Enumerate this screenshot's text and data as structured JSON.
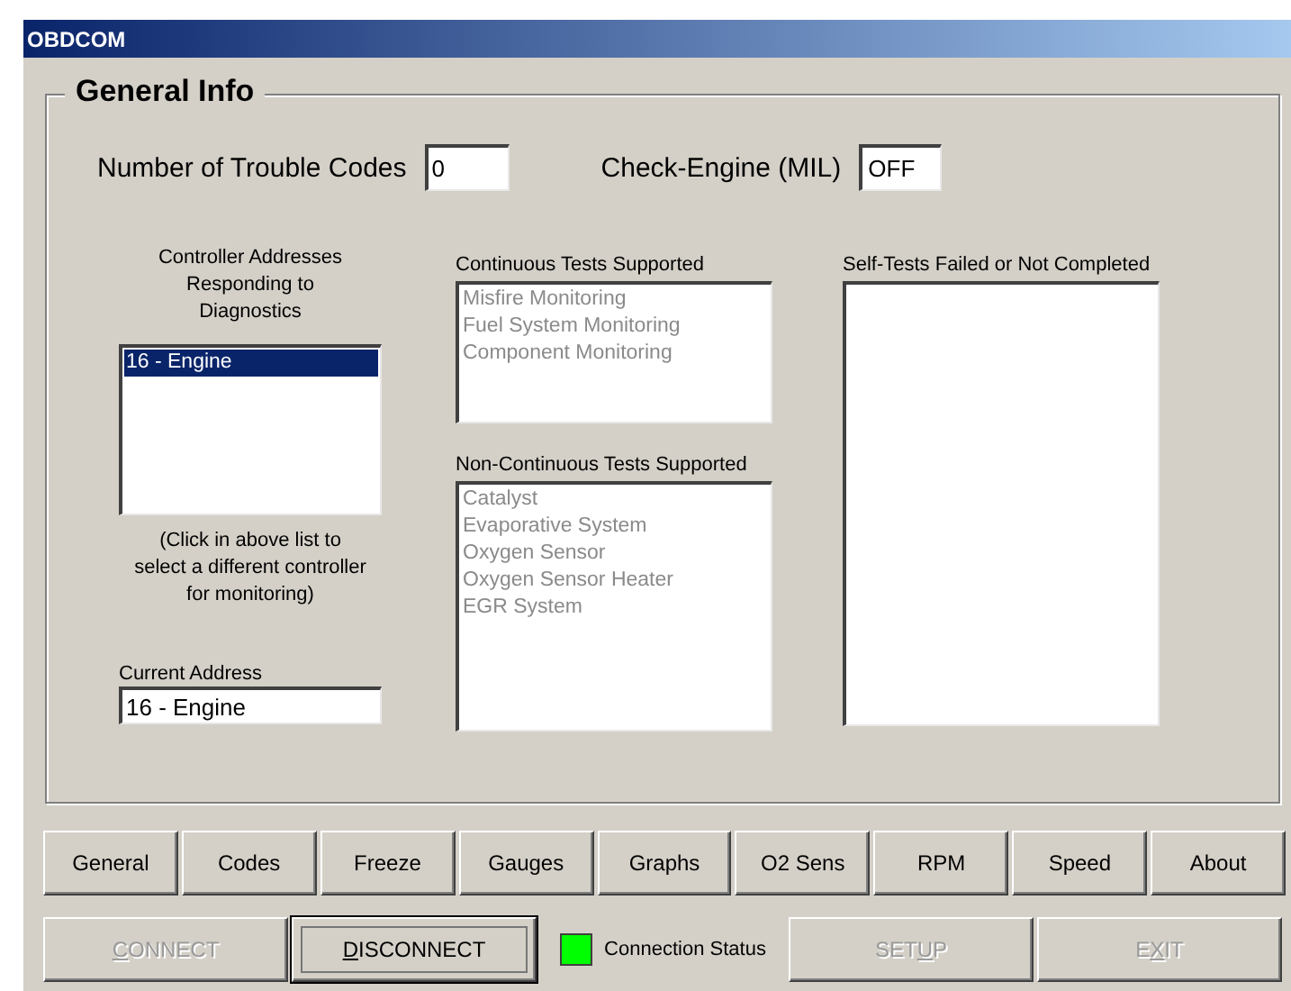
{
  "window": {
    "title": "OBDCOM"
  },
  "group": {
    "title": "General Info"
  },
  "trouble_codes": {
    "label": "Number of Trouble Codes",
    "value": "0"
  },
  "mil": {
    "label": "Check-Engine (MIL)",
    "value": "OFF"
  },
  "controllers": {
    "heading": "Controller Addresses Responding to Diagnostics",
    "items": [
      {
        "label": "16 - Engine",
        "selected": true
      }
    ],
    "note": "(Click in above list to select a different controller for monitoring)"
  },
  "current_address": {
    "label": "Current Address",
    "value": "16 - Engine"
  },
  "continuous": {
    "heading": "Continuous Tests Supported",
    "disabled": true,
    "items": [
      "Misfire Monitoring",
      "Fuel System Monitoring",
      "Component Monitoring"
    ]
  },
  "non_continuous": {
    "heading": "Non-Continuous Tests Supported",
    "disabled": true,
    "items": [
      "Catalyst",
      "Evaporative System",
      "Oxygen Sensor",
      "Oxygen Sensor Heater",
      "EGR System"
    ]
  },
  "self_tests": {
    "heading": "Self-Tests Failed or Not Completed"
  },
  "tabs": [
    "General",
    "Codes",
    "Freeze",
    "Gauges",
    "Graphs",
    "O2 Sens",
    "RPM",
    "Speed",
    "About"
  ],
  "actions": [
    {
      "key": "C",
      "after": "ONNECT",
      "disabled": true,
      "default": false
    },
    {
      "key": "D",
      "after": "ISCONNECT",
      "disabled": false,
      "default": true
    },
    {
      "kind": "status",
      "color": "#00ff00",
      "label": "Connection Status"
    },
    {
      "before": "SET",
      "key": "U",
      "after": "P",
      "disabled": true,
      "default": false
    },
    {
      "before": "E",
      "key": "X",
      "after": "IT",
      "disabled": true,
      "default": false
    }
  ]
}
